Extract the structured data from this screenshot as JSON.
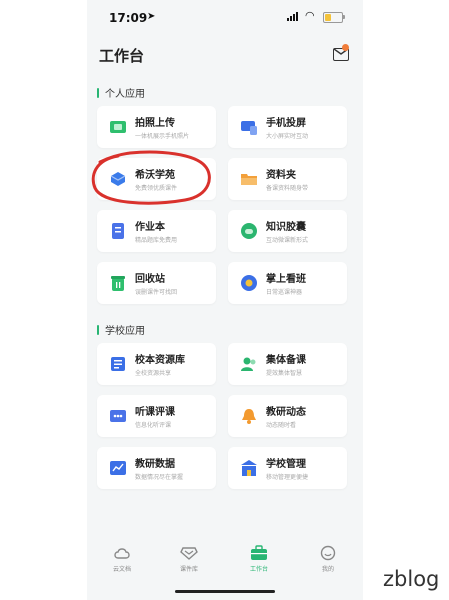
{
  "status": {
    "time": "17:09"
  },
  "header": {
    "title": "工作台"
  },
  "sections": [
    {
      "title": "个人应用"
    },
    {
      "title": "学校应用"
    }
  ],
  "personal_apps": [
    {
      "name": "拍照上传",
      "desc": "一体机展示手机照片",
      "icon": "camera-upload-icon",
      "color": "#2fbf6e"
    },
    {
      "name": "手机投屏",
      "desc": "大小屏实时互动",
      "icon": "screen-cast-icon",
      "color": "#3b6fe6"
    },
    {
      "name": "希沃学苑",
      "desc": "免费领优质课件",
      "icon": "seewo-academy-icon",
      "color": "#3a7bea"
    },
    {
      "name": "资料夹",
      "desc": "备课资料随身带",
      "icon": "folder-icon",
      "color": "#f3a03a"
    },
    {
      "name": "作业本",
      "desc": "精品题库免费用",
      "icon": "homework-icon",
      "color": "#4a72e8"
    },
    {
      "name": "知识胶囊",
      "desc": "互动微课新形式",
      "icon": "knowledge-capsule-icon",
      "color": "#2bb56f"
    },
    {
      "name": "回收站",
      "desc": "误删课件可找回",
      "icon": "recycle-bin-icon",
      "color": "#2fbf6e"
    },
    {
      "name": "掌上看班",
      "desc": "日常巡课神器",
      "icon": "class-monitor-icon",
      "color": "#3b6fe6"
    }
  ],
  "school_apps": [
    {
      "name": "校本资源库",
      "desc": "全校资源共享",
      "icon": "resource-library-icon",
      "color": "#3b6fe6"
    },
    {
      "name": "集体备课",
      "desc": "提效集体智慧",
      "icon": "group-prep-icon",
      "color": "#2bb56f"
    },
    {
      "name": "听课评课",
      "desc": "信息化听评课",
      "icon": "lesson-review-icon",
      "color": "#4a72e8"
    },
    {
      "name": "教研动态",
      "desc": "动态随时看",
      "icon": "research-news-icon",
      "color": "#f39a2f"
    },
    {
      "name": "教研数据",
      "desc": "数据情况尽在掌握",
      "icon": "research-data-icon",
      "color": "#3b6fe6"
    },
    {
      "name": "学校管理",
      "desc": "移动管理更便捷",
      "icon": "school-management-icon",
      "color": "#3b6fe6"
    }
  ],
  "tabs": [
    {
      "label": "云文档",
      "icon": "cloud-doc-icon"
    },
    {
      "label": "课件库",
      "icon": "courseware-icon"
    },
    {
      "label": "工作台",
      "icon": "workbench-icon",
      "active": true
    },
    {
      "label": "我的",
      "icon": "profile-icon"
    }
  ],
  "colors": {
    "accent": "#28b573",
    "annotation_red": "#d9312c"
  },
  "watermark": "zblog"
}
